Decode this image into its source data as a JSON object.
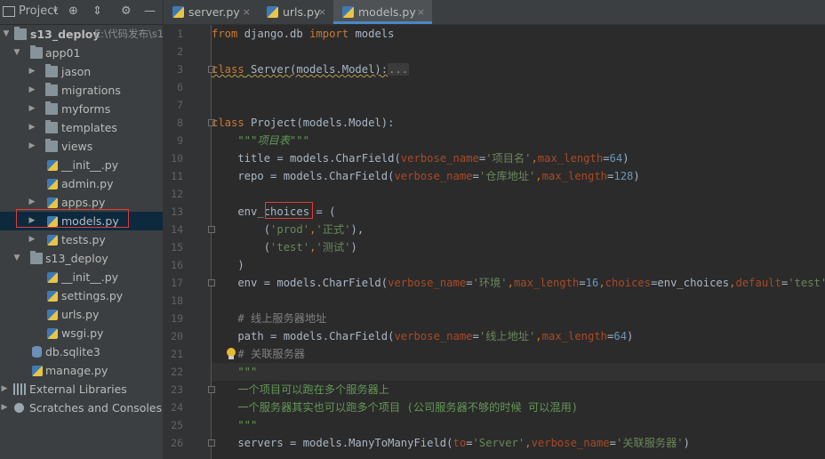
{
  "toolbar": {
    "project_label": "Project",
    "dropdown_icon": "chevron-down-icon",
    "target_icon": "crosshair-icon",
    "collapse_icon": "collapse-all-icon",
    "settings_icon": "gear-icon",
    "hide_icon": "minimize-icon"
  },
  "tree": {
    "root": {
      "name": "s13_deploy",
      "path": "E:\\代码发布\\s1"
    },
    "app01": "app01",
    "jason": "jason",
    "migrations": "migrations",
    "myforms": "myforms",
    "templates": "templates",
    "views": "views",
    "app01_init": "__init__.py",
    "admin": "admin.py",
    "apps": "apps.py",
    "models": "models.py",
    "tests": "tests.py",
    "s13_deploy_pkg": "s13_deploy",
    "pkg_init": "__init__.py",
    "settings": "settings.py",
    "urls": "urls.py",
    "wsgi": "wsgi.py",
    "db": "db.sqlite3",
    "manage": "manage.py",
    "external_libraries": "External Libraries",
    "scratches": "Scratches and Consoles"
  },
  "tabs": [
    {
      "label": "server.py",
      "active": false
    },
    {
      "label": "urls.py",
      "active": false
    },
    {
      "label": "models.py",
      "active": true
    }
  ],
  "tab_close": "×",
  "line_numbers": [
    "1",
    "2",
    "3",
    "6",
    "7",
    "8",
    "9",
    "10",
    "11",
    "12",
    "13",
    "14",
    "15",
    "16",
    "17",
    "18",
    "19",
    "20",
    "21",
    "22",
    "23",
    "24",
    "25",
    "26"
  ],
  "code": {
    "l1": {
      "from": "from",
      "mod": " django.db ",
      "import": "import",
      "rest": " models"
    },
    "l3": {
      "kw": "class",
      "rest": " Server(models.Model):",
      "fold": "..."
    },
    "l8": {
      "kw": "class",
      "rest": " Project(models.Model):"
    },
    "l9": {
      "doc": "    \"\"\"项目表\"\"\""
    },
    "l10": {
      "a": "    title = models.CharField(",
      "p1": "verbose_name",
      "eq1": "=",
      "s1": "'项目名'",
      "c1": ",",
      "p2": "max_length",
      "eq2": "=",
      "n1": "64",
      "end": ")"
    },
    "l11": {
      "a": "    repo = models.CharField(",
      "p1": "verbose_name",
      "eq1": "=",
      "s1": "'仓库地址'",
      "c1": ",",
      "p2": "max_length",
      "eq2": "=",
      "n1": "128",
      "end": ")"
    },
    "l13": {
      "a": "    env_",
      "b": "choices",
      "c": " = ("
    },
    "l14": {
      "a": "        (",
      "s1": "'prod'",
      "c1": ",",
      "s2": "'正式'",
      "end": "),"
    },
    "l15": {
      "a": "        (",
      "s1": "'test'",
      "c1": ",",
      "s2": "'测试'",
      "end": ")"
    },
    "l16": {
      "a": "    )"
    },
    "l17": {
      "a": "    env = models.CharField(",
      "p1": "verbose_name",
      "eq1": "=",
      "s1": "'环境'",
      "c1": ",",
      "p2": "max_length",
      "eq2": "=",
      "n1": "16",
      "c2": ",",
      "p3": "choices",
      "eq3": "=env_choices",
      "c3": ",",
      "p4": "default",
      "eq4": "=",
      "s2": "'test'",
      "end": ")"
    },
    "l19": {
      "cmt": "    # 线上服务器地址"
    },
    "l20": {
      "a": "    path = models.CharField(",
      "p1": "verbose_name",
      "eq1": "=",
      "s1": "'线上地址'",
      "c1": ",",
      "p2": "max_length",
      "eq2": "=",
      "n1": "64",
      "end": ")"
    },
    "l21": {
      "cmt": "    # 关联服务器"
    },
    "l22": {
      "doc": "    \"\"\""
    },
    "l23": {
      "doc": "    一个项目可以跑在多个服务器上"
    },
    "l24": {
      "doc": "    一个服务器其实也可以跑多个项目 (公司服务器不够的时候 可以混用)"
    },
    "l25": {
      "doc": "    \"\"\""
    },
    "l26": {
      "a": "    servers = models.ManyToManyField(",
      "p1": "to",
      "eq1": "=",
      "s1": "'Server'",
      "c1": ",",
      "p2": "verbose_name",
      "eq2": "=",
      "s2": "'关联服务器'",
      "end": ")"
    }
  }
}
